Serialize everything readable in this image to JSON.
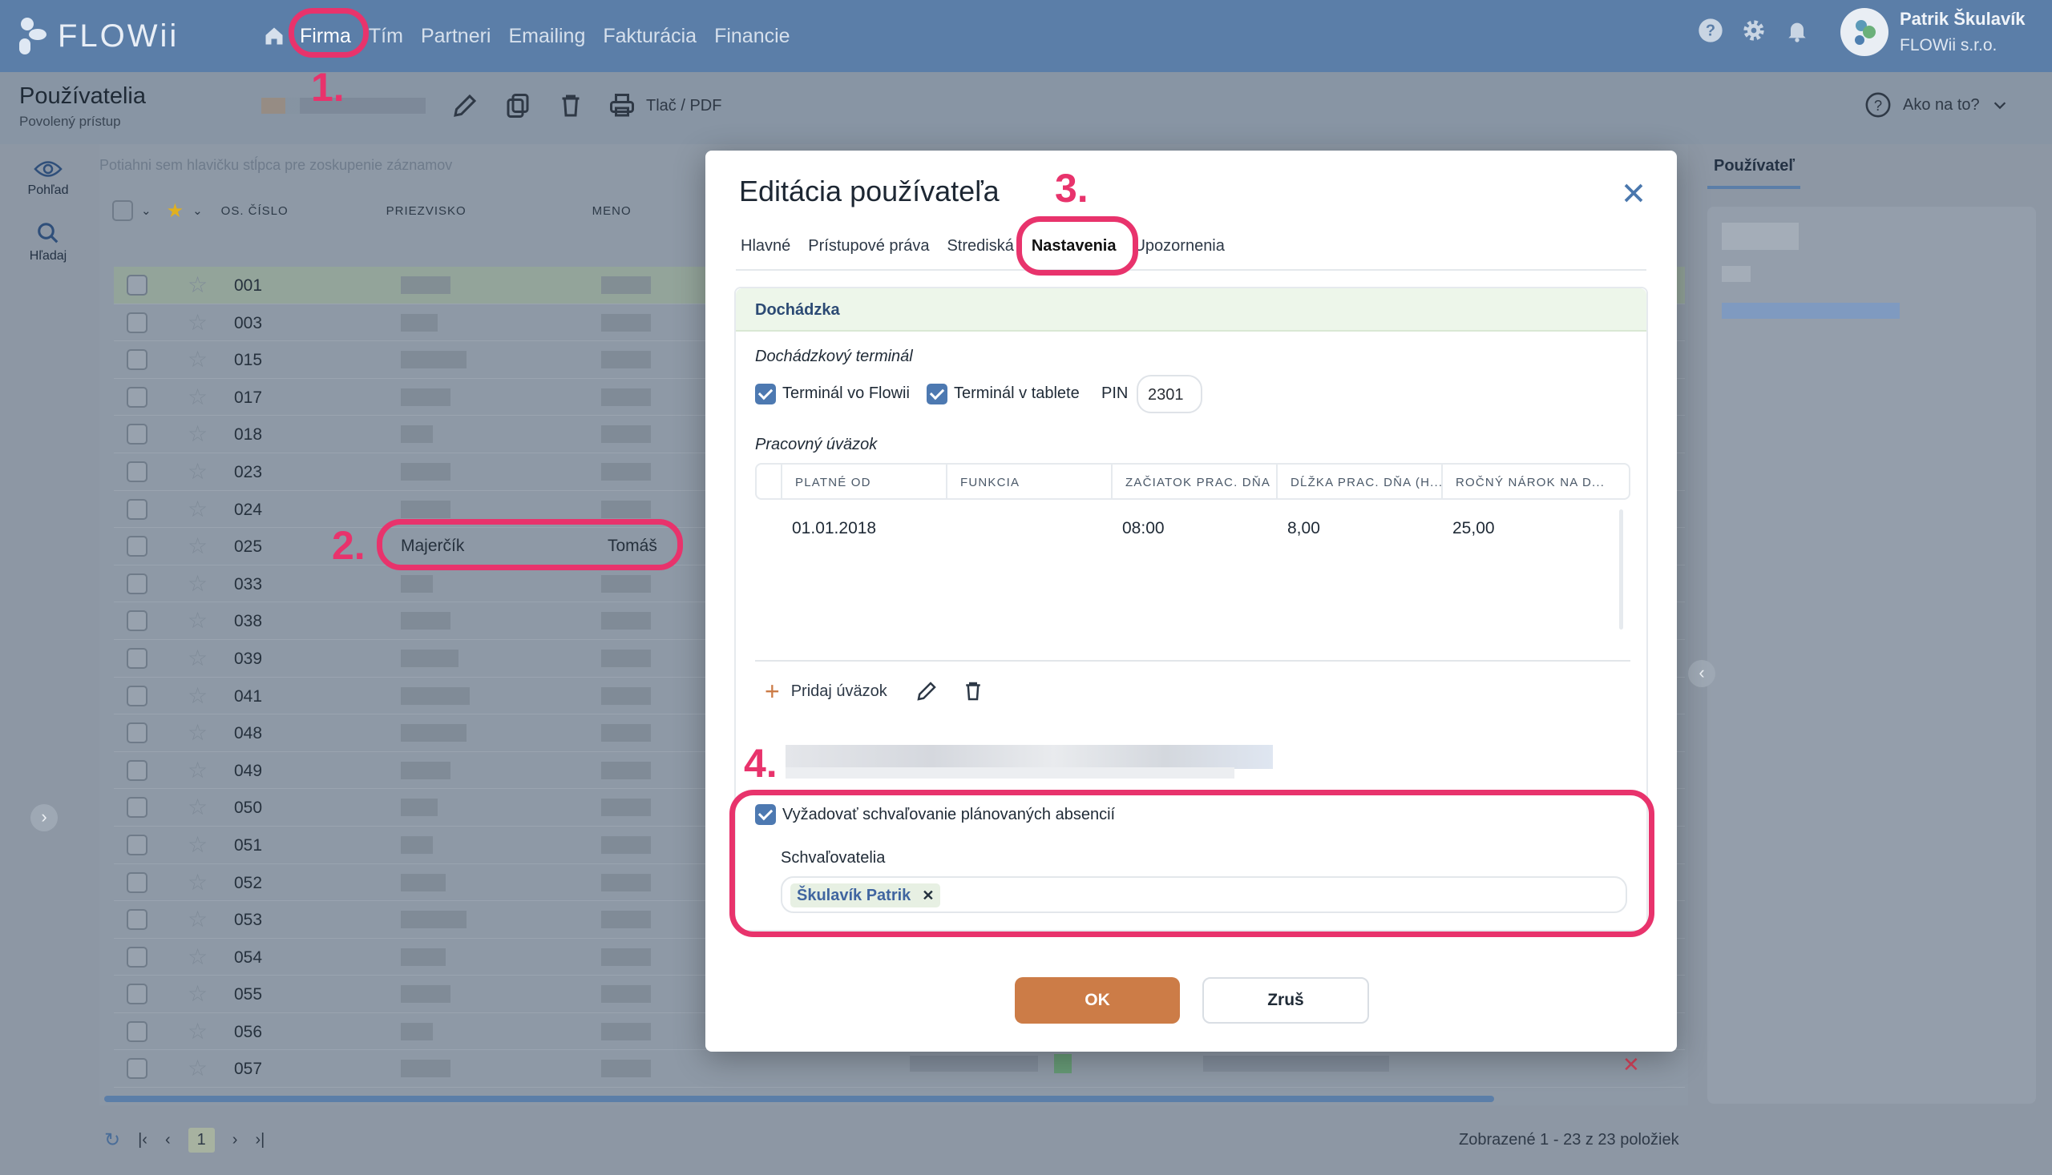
{
  "app": {
    "logo_text": "FLOWii"
  },
  "nav": {
    "items": [
      "Firma",
      "Tím",
      "Partneri",
      "Emailing",
      "Fakturácia",
      "Financie"
    ]
  },
  "user": {
    "name": "Patrik Škulavík",
    "company": "FLOWii s.r.o."
  },
  "page": {
    "title": "Používatelia",
    "subtitle": "Povolený prístup"
  },
  "toolbar": {
    "print_label": "Tlač / PDF",
    "help_label": "Ako na to?"
  },
  "rail": {
    "view_label": "Pohľad",
    "search_label": "Hľadaj"
  },
  "grid": {
    "drag_hint": "Potiahni sem hlavičku stĺpca pre zoskupenie záznamov",
    "headers": {
      "number": "OS. ČÍSLO",
      "surname": "PRIEZVISKO",
      "name": "MENO"
    },
    "rows": [
      "001",
      "003",
      "015",
      "017",
      "018",
      "023",
      "024",
      "025",
      "033",
      "038",
      "039",
      "041",
      "048",
      "049",
      "050",
      "051",
      "052",
      "053",
      "054",
      "055",
      "056",
      "057"
    ],
    "highlight_row": {
      "number": "025",
      "surname": "Majerčík",
      "name": "Tomáš"
    },
    "page": "1",
    "count_text": "Zobrazené 1 - 23 z 23 položiek"
  },
  "right_panel": {
    "tab": "Používateľ"
  },
  "modal": {
    "title": "Editácia používateľa",
    "tabs": [
      "Hlavné",
      "Prístupové práva",
      "Strediská",
      "Nastavenia",
      "Upozornenia"
    ],
    "active_tab": "Nastavenia",
    "section_title": "Dochádzka",
    "terminal_label": "Dochádzkový terminál",
    "terminal_flowii": "Terminál vo Flowii",
    "terminal_tablet": "Terminál v tablete",
    "pin_label": "PIN",
    "pin_value": "2301",
    "workload_label": "Pracovný úväzok",
    "workload_headers": [
      "PLATNÉ OD",
      "FUNKCIA",
      "ZAČIATOK PRAC. DŇA",
      "DĹŽKA PRAC. DŇA (H...",
      "ROČNÝ NÁROK NA D..."
    ],
    "workload_row": {
      "valid_from": "01.01.2018",
      "function": "",
      "start": "08:00",
      "length": "8,00",
      "annual": "25,00"
    },
    "add_workload": "Pridaj úväzok",
    "require_approval": "Vyžadovať schvaľovanie plánovaných absencií",
    "approvers_label": "Schvaľovatelia",
    "approver_chip": "Škulavík Patrik",
    "ok_label": "OK",
    "cancel_label": "Zruš"
  },
  "callouts": [
    "1.",
    "2.",
    "3.",
    "4."
  ],
  "colors": {
    "accent": "#5b7ea8",
    "highlight": "#e8336c",
    "ok_button": "#cc7c47"
  }
}
